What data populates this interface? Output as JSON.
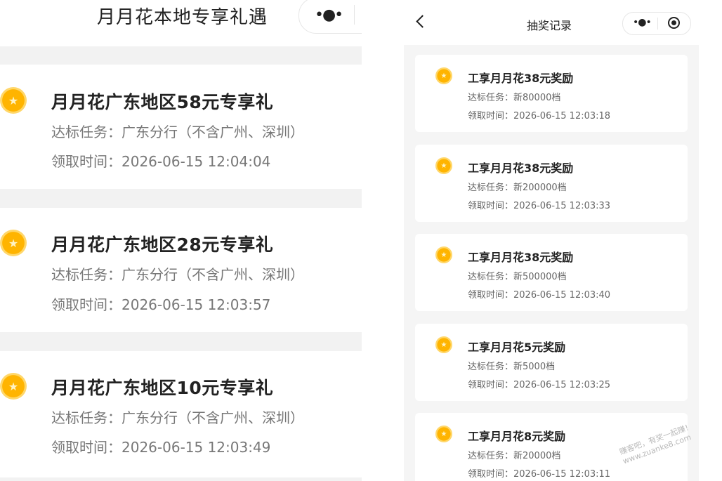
{
  "left": {
    "title": "月月花本地专享礼遇",
    "menu_dots": "•●•",
    "cards": [
      {
        "title": "月月花广东地区58元专享礼",
        "task": "达标任务：广东分行（不含广州、深圳）",
        "time": "领取时间：2026-06-15 12:04:04"
      },
      {
        "title": "月月花广东地区28元专享礼",
        "task": "达标任务：广东分行（不含广州、深圳）",
        "time": "领取时间：2026-06-15 12:03:57"
      },
      {
        "title": "月月花广东地区10元专享礼",
        "task": "达标任务：广东分行（不含广州、深圳）",
        "time": "领取时间：2026-06-15 12:03:49"
      }
    ]
  },
  "right": {
    "title": "抽奖记录",
    "menu_dots": "•●•",
    "cards": [
      {
        "title": "工享月月花38元奖励",
        "task": "达标任务：新80000档",
        "time": "领取时间：2026-06-15 12:03:18"
      },
      {
        "title": "工享月月花38元奖励",
        "task": "达标任务：新200000档",
        "time": "领取时间：2026-06-15 12:03:33"
      },
      {
        "title": "工享月月花38元奖励",
        "task": "达标任务：新500000档",
        "time": "领取时间：2026-06-15 12:03:40"
      },
      {
        "title": "工享月月花5元奖励",
        "task": "达标任务：新5000档",
        "time": "领取时间：2026-06-15 12:03:25"
      },
      {
        "title": "工享月月花8元奖励",
        "task": "达标任务：新20000档",
        "time": "领取时间：2026-06-15 12:03:11"
      }
    ]
  },
  "icons": {
    "coin": "star-coin-icon",
    "back": "chevron-left-icon",
    "more": "more-dots-icon",
    "close": "target-close-icon"
  },
  "colors": {
    "coin": "#ffb400",
    "coin_ring": "#ffd76a",
    "page_bg": "#f5f5f5"
  },
  "watermark": "赚客吧，有奖一起赚！www.zuanke8.com"
}
